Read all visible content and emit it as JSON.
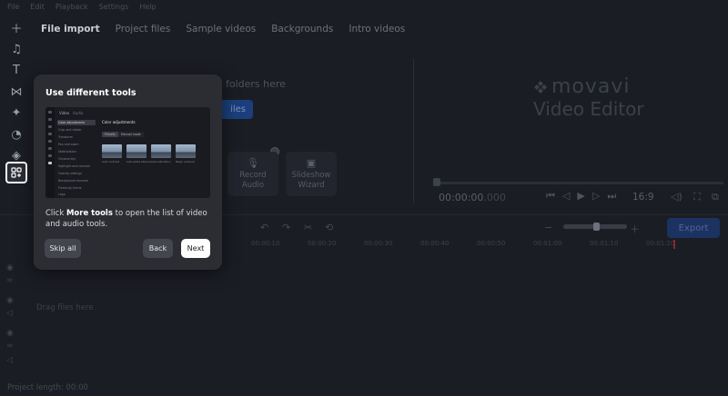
{
  "menu": [
    "File",
    "Edit",
    "Playback",
    "Settings",
    "Help"
  ],
  "tabs": [
    {
      "label": "File import",
      "active": true
    },
    {
      "label": "Project files",
      "active": false
    },
    {
      "label": "Sample videos",
      "active": false
    },
    {
      "label": "Backgrounds",
      "active": false
    },
    {
      "label": "Intro videos",
      "active": false
    }
  ],
  "import": {
    "drop_hint": "folders here",
    "add_files_label": "iles",
    "cards": [
      {
        "label": "Record\nAudio",
        "icon": "microphone-icon"
      },
      {
        "label": "Slideshow\nWizard",
        "icon": "slideshow-icon"
      }
    ]
  },
  "preview": {
    "logo_text": "movavi",
    "logo_sub": "Video Editor",
    "timecode": "00:00:00",
    "timecode_ms": ".000",
    "aspect": "16:9"
  },
  "timeline": {
    "export_label": "Export",
    "ruler": [
      "00:00:10",
      "00:00:20",
      "00:00:30",
      "00:00:40",
      "00:00:50",
      "00:01:00",
      "00:01:10",
      "00:01:20",
      "00:01:30",
      "00:01:40"
    ],
    "drop_files": "Drag files here",
    "project_length": "Project length: 00:00"
  },
  "popup": {
    "title": "Use different tools",
    "desc_before": "Click ",
    "desc_bold": "More tools",
    "desc_after": " to open the list of video and audio tools.",
    "skip_label": "Skip all",
    "back_label": "Back",
    "next_label": "Next",
    "shot": {
      "tab_video": "Video",
      "tab_audio": "Audio",
      "menu": [
        "Color adjustments",
        "Crop and rotate",
        "Transform",
        "Pan and zoom",
        "Stabilization",
        "Chroma key",
        "Highlight and conceal",
        "Overlay settings",
        "Background removal",
        "Frame-by-frame",
        "Logo"
      ],
      "pane_title": "Color adjustments",
      "chips": [
        "Presets",
        "Manual mode"
      ],
      "thumbs": [
        "Auto contrast",
        "Auto white balance",
        "Auto saturation",
        "Magic enhance"
      ]
    }
  },
  "colors": {
    "background": "#1b1d24",
    "popup": "#2b2d33",
    "accent": "#1b3f7d",
    "next_button": "#ffffff"
  }
}
